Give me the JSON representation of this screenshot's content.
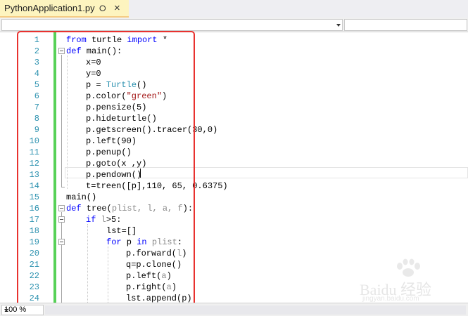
{
  "tab": {
    "title": "PythonApplication1.py",
    "pin_icon": "pin-icon",
    "close_icon": "close-icon"
  },
  "zoom": {
    "value": "100 %"
  },
  "code_lines": [
    [
      "1",
      "from turtle import *"
    ],
    [
      "2",
      "def main():"
    ],
    [
      "3",
      "x=0"
    ],
    [
      "4",
      "y=0"
    ],
    [
      "5",
      "p = Turtle()"
    ],
    [
      "6",
      "p.color(\"green\")"
    ],
    [
      "7",
      "p.pensize(5)"
    ],
    [
      "8",
      "p.hideturtle()"
    ],
    [
      "9",
      "p.getscreen().tracer(30,0)"
    ],
    [
      "10",
      "p.left(90)"
    ],
    [
      "11",
      "p.penup()"
    ],
    [
      "12",
      "p.goto(x ,y)"
    ],
    [
      "13",
      "p.pendown()"
    ],
    [
      "14",
      "t=treen([p],110, 65, 0.6375)"
    ],
    [
      "15",
      "main()"
    ],
    [
      "16",
      "def tree(plist, l, a, f):"
    ],
    [
      "17",
      "if l>5:"
    ],
    [
      "18",
      "lst=[]"
    ],
    [
      "19",
      "for p in plist:"
    ],
    [
      "20",
      "p.forward(l)"
    ],
    [
      "21",
      "q=p.clone()"
    ],
    [
      "22",
      "p.left(a)"
    ],
    [
      "23",
      "p.right(a)"
    ],
    [
      "24",
      "lst.append(p)"
    ]
  ],
  "watermark": {
    "text": "Baidu 经验",
    "url": "jingyan.baidu.com"
  },
  "colors": {
    "keyword": "#0000ff",
    "type": "#2b91af",
    "string": "#a31515",
    "line_number": "#2b91af",
    "annotation": "#e8322f",
    "change_bar": "#57d157"
  }
}
